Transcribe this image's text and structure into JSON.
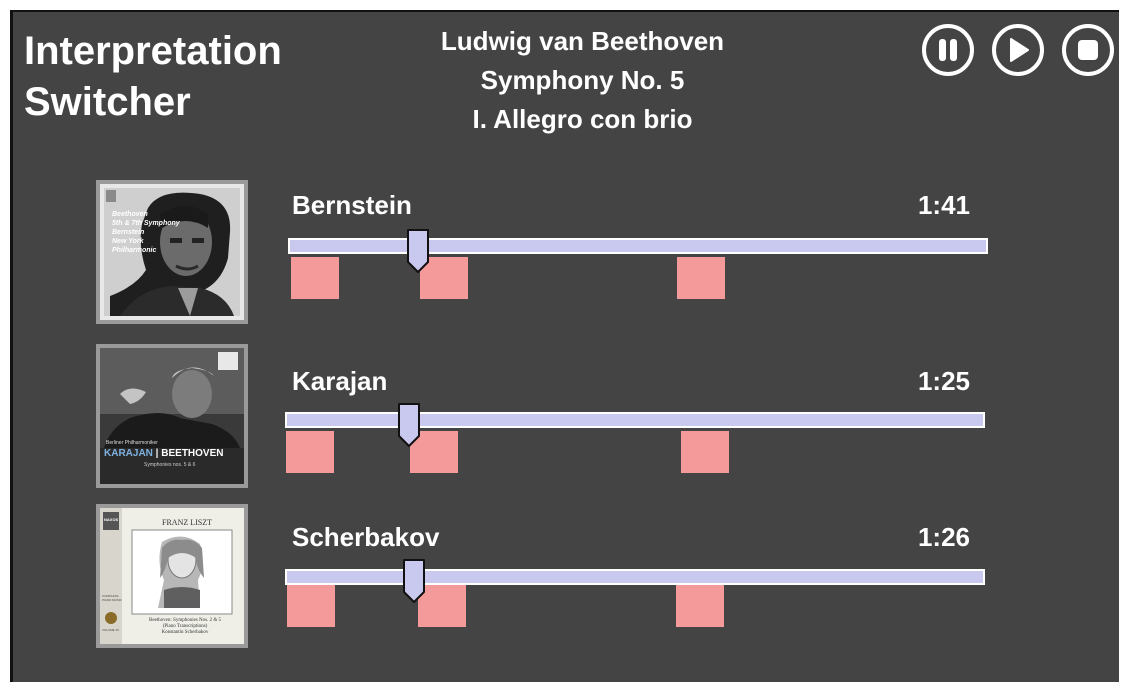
{
  "app": {
    "title_line1": "Interpretation",
    "title_line2": "Switcher"
  },
  "piece": {
    "composer": "Ludwig van Beethoven",
    "work": "Symphony No. 5",
    "movement": "I. Allegro con brio"
  },
  "controls": {
    "pause": "pause-icon",
    "play": "play-icon",
    "stop": "stop-icon"
  },
  "colors": {
    "background": "#444444",
    "timeline": "#c9c9f0",
    "marker": "#f59a9a",
    "text": "#ffffff"
  },
  "tracks": [
    {
      "performer": "Bernstein",
      "time": "1:41",
      "cover": {
        "lines": [
          "Beethoven",
          "5th & 7th Symphony",
          "Bernstein",
          "New York",
          "Philharmonic"
        ]
      }
    },
    {
      "performer": "Karajan",
      "time": "1:25",
      "cover": {
        "header": "Berliner Philharmoniker",
        "name": "KARAJAN",
        "composer": "BEETHOVEN",
        "subtitle": "Symphonies nos. 5 & 6"
      }
    },
    {
      "performer": "Scherbakov",
      "time": "1:26",
      "cover": {
        "title": "FRANZ LISZT",
        "label": "NAXOS",
        "series": "COMPLETE PIANO MUSIC",
        "volume": "VOLUME 15",
        "subtitle": "Beethoven: Symphonies Nos. 2 & 5",
        "note": "(Piano Transcriptions)",
        "artist": "Konstantin Scherbakov"
      }
    }
  ]
}
